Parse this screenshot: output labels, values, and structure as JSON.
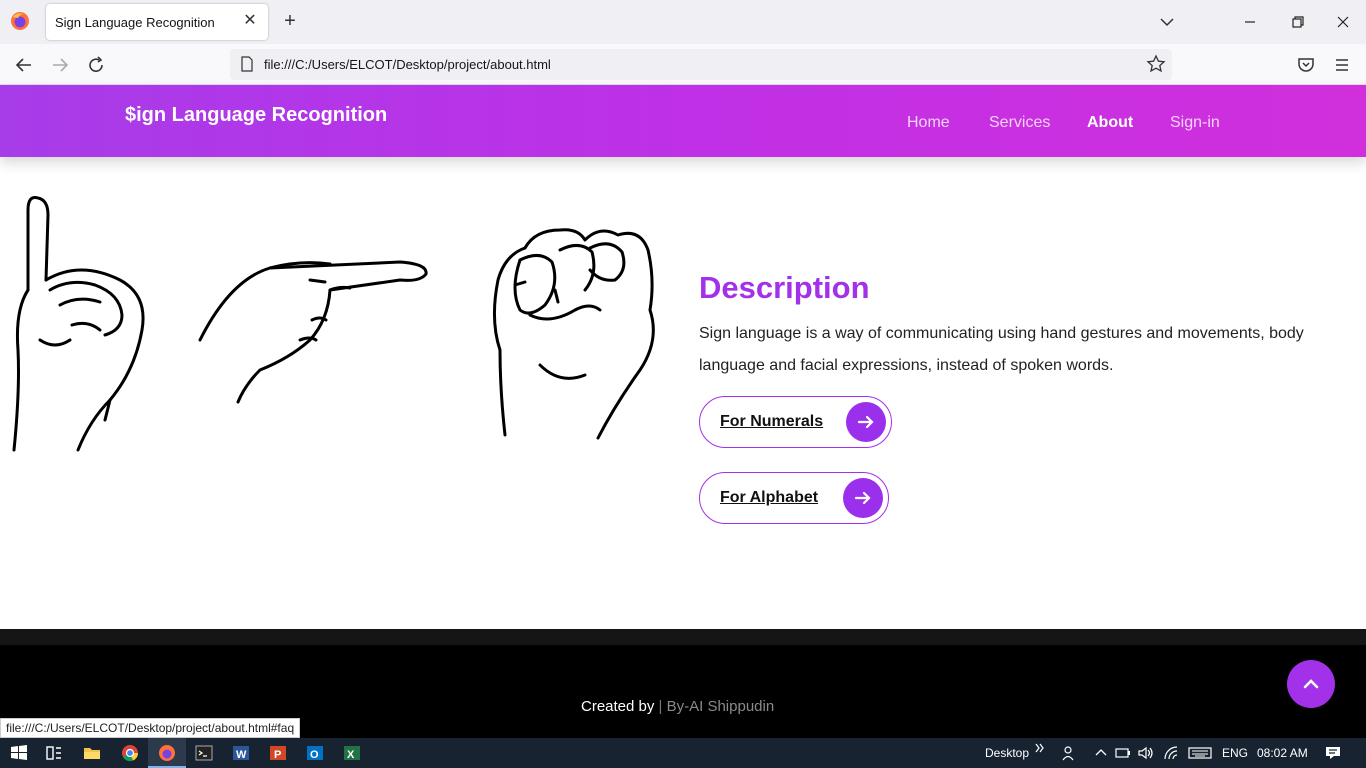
{
  "browser": {
    "tab_title": "Sign Language Recognition",
    "tab_close": "✕",
    "new_tab": "+",
    "url": "file:///C:/Users/ELCOT/Desktop/project/about.html",
    "status_url": "file:///C:/Users/ELCOT/Desktop/project/about.html#faq"
  },
  "site": {
    "brand": "$ign Language Recognition",
    "menu": [
      {
        "label": "Home",
        "active": false
      },
      {
        "label": "Services",
        "active": false
      },
      {
        "label": "About",
        "active": true
      },
      {
        "label": "Sign-in",
        "active": false
      }
    ],
    "description": {
      "title": "Description",
      "text": "Sign language is a way of communicating using hand gestures and movements, body language and facial expressions, instead of spoken words."
    },
    "buttons": [
      {
        "label": "For Numerals"
      },
      {
        "label": "For Alphabet"
      }
    ],
    "footer": {
      "created_by": "Created by",
      "separator": "|",
      "author": "By-AI Shippudin"
    }
  },
  "taskbar": {
    "desktop_label": "Desktop",
    "language": "ENG",
    "time": "08:02 AM"
  },
  "colors": {
    "accent": "#a331e9",
    "header_gradient_start": "#a73ce9",
    "header_gradient_end": "#d12fdc",
    "footer": "#000000"
  }
}
